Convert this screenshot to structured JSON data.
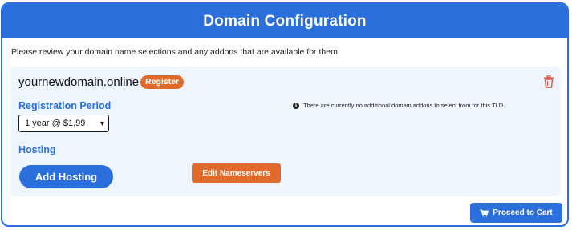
{
  "header": {
    "title": "Domain Configuration"
  },
  "intro_text": "Please review your domain name selections and any addons that are available for them.",
  "domain": {
    "name": "yournewdomain.online",
    "badge": "Register",
    "registration_period_label": "Registration Period",
    "registration_period_value": "1 year @ $1.99",
    "hosting_label": "Hosting",
    "add_hosting_label": "Add Hosting",
    "edit_nameservers_label": "Edit Nameservers",
    "addons_note": "There are currently no additional domain addons to select from for this TLD."
  },
  "footer": {
    "proceed_label": "Proceed to Cart"
  },
  "colors": {
    "primary": "#2a6fdb",
    "accent": "#e06a2c",
    "box_bg": "#eef5fc"
  },
  "icons": {
    "delete": "trash-icon",
    "info": "info-icon",
    "cart": "cart-icon",
    "dropdown": "chevron-down-icon"
  }
}
